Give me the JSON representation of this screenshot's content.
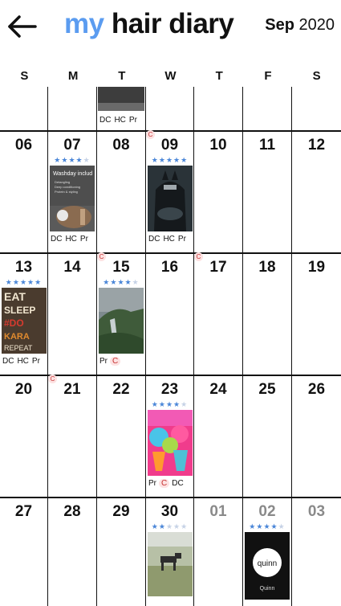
{
  "header": {
    "title_my": "my",
    "title_rest": "hair diary",
    "month": "Sep",
    "year": "2020"
  },
  "weekdays": [
    "S",
    "M",
    "T",
    "W",
    "T",
    "F",
    "S"
  ],
  "tags": {
    "dc": "DC",
    "hc": "HC",
    "pr": "Pr",
    "c": "C"
  },
  "weeks": [
    {
      "days": [
        {
          "num": ""
        },
        {
          "num": ""
        },
        {
          "num": "",
          "thumb": "gray",
          "tags": [
            "DC",
            "HC",
            "Pr"
          ],
          "cmark": true
        },
        {
          "num": ""
        },
        {
          "num": ""
        },
        {
          "num": ""
        },
        {
          "num": ""
        }
      ]
    },
    {
      "days": [
        {
          "num": "06"
        },
        {
          "num": "07",
          "stars": 4,
          "thumb": "washday",
          "tags": [
            "DC",
            "HC",
            "Pr"
          ],
          "cmark": true,
          "thumb_text": "Washday includes"
        },
        {
          "num": "08"
        },
        {
          "num": "09",
          "stars": 5,
          "thumb": "batman",
          "tags": [
            "DC",
            "HC",
            "Pr"
          ],
          "cmark": true
        },
        {
          "num": "10"
        },
        {
          "num": "11"
        },
        {
          "num": "12"
        }
      ]
    },
    {
      "days": [
        {
          "num": "13",
          "stars": 5,
          "thumb": "eatsleep",
          "tags": [
            "DC",
            "HC",
            "Pr"
          ],
          "cmark": true,
          "thumb_text": "EAT SLEEP"
        },
        {
          "num": "14"
        },
        {
          "num": "15",
          "stars": 4,
          "thumb": "waterfall",
          "tags": [
            "Pr",
            "C"
          ]
        },
        {
          "num": "16"
        },
        {
          "num": "17"
        },
        {
          "num": "18"
        },
        {
          "num": "19"
        }
      ]
    },
    {
      "days": [
        {
          "num": "20"
        },
        {
          "num": "21"
        },
        {
          "num": "22"
        },
        {
          "num": "23",
          "stars": 4,
          "thumb": "colorful",
          "tags": [
            "Pr",
            "C",
            "DC"
          ]
        },
        {
          "num": "24"
        },
        {
          "num": "25"
        },
        {
          "num": "26"
        }
      ]
    },
    {
      "days": [
        {
          "num": "27"
        },
        {
          "num": "28"
        },
        {
          "num": "29"
        },
        {
          "num": "30",
          "stars": 2,
          "thumb": "dog"
        },
        {
          "num": "01",
          "dim": true
        },
        {
          "num": "02",
          "dim": true,
          "stars": 4,
          "thumb": "quinn",
          "thumb_text": "quinn",
          "thumb_caption": "Quinn"
        },
        {
          "num": "03",
          "dim": true
        }
      ]
    }
  ]
}
